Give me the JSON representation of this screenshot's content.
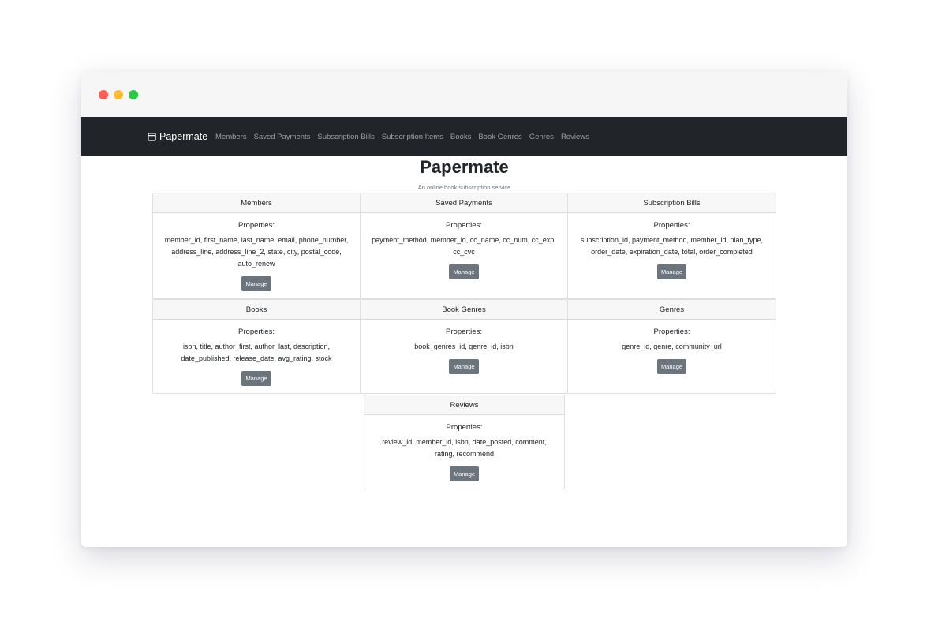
{
  "app": {
    "brand": "Papermate",
    "title": "Papermate",
    "subtitle": "An online book subscription service"
  },
  "nav": {
    "links": [
      "Members",
      "Saved Payments",
      "Subscription Bills",
      "Subscription Items",
      "Books",
      "Book Genres",
      "Genres",
      "Reviews"
    ]
  },
  "cards": [
    {
      "title": "Members",
      "properties_label": "Properties:",
      "properties": "member_id, first_name, last_name, email, phone_number, address_line, address_line_2, state, city, postal_code, auto_renew",
      "button": "Manage"
    },
    {
      "title": "Saved Payments",
      "properties_label": "Properties:",
      "properties": "payment_method, member_id, cc_name, cc_num, cc_exp, cc_cvc",
      "button": "Manage"
    },
    {
      "title": "Subscription Bills",
      "properties_label": "Properties:",
      "properties": "subscription_id, payment_method, member_id, plan_type, order_date, expiration_date, total, order_completed",
      "button": "Manage"
    },
    {
      "title": "Books",
      "properties_label": "Properties:",
      "properties": "isbn, title, author_first, author_last, description, date_published, release_date, avg_rating, stock",
      "button": "Manage"
    },
    {
      "title": "Book Genres",
      "properties_label": "Properties:",
      "properties": "book_genres_id, genre_id, isbn",
      "button": "Manage"
    },
    {
      "title": "Genres",
      "properties_label": "Properties:",
      "properties": "genre_id, genre, community_url",
      "button": "Manage"
    },
    {
      "title": "Reviews",
      "properties_label": "Properties:",
      "properties": "review_id, member_id, isbn, date_posted, comment, rating, recommend",
      "button": "Manage"
    }
  ]
}
